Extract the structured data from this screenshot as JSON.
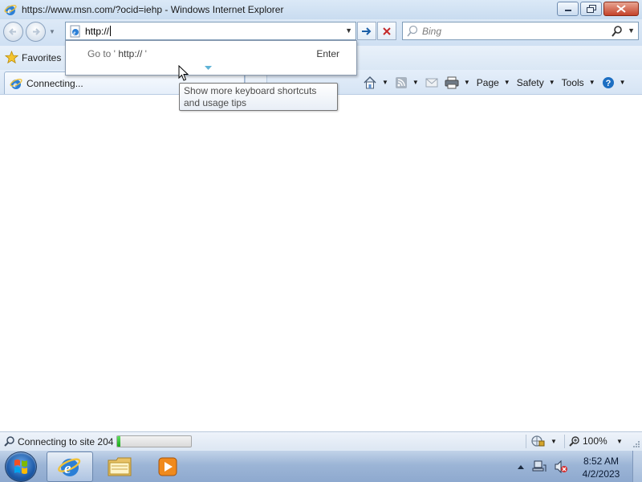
{
  "window": {
    "title": "https://www.msn.com/?ocid=iehp - Windows Internet Explorer",
    "icon": "ie-icon",
    "buttons": [
      "minimize-icon",
      "maximize-icon",
      "close-icon"
    ]
  },
  "navigation": {
    "address_value": "http://",
    "search_placeholder": "Bing"
  },
  "address_dropdown": {
    "goto_prefix": "Go to '",
    "goto_url": " http:// ",
    "goto_suffix": "'",
    "shortcut": "Enter"
  },
  "tooltip": {
    "text": "Show more keyboard shortcuts and usage tips"
  },
  "favorites_bar": {
    "label": "Favorites"
  },
  "tab": {
    "label": "Connecting..."
  },
  "command_bar": {
    "page": "Page",
    "safety": "Safety",
    "tools": "Tools"
  },
  "status_bar": {
    "text": "Connecting to site 204",
    "progress": 0.04,
    "zoom": "100%"
  },
  "taskbar": {
    "apps": [
      "ie-icon",
      "folder-icon",
      "media-player-icon"
    ],
    "active_app": "ie-icon",
    "time": "8:52 AM",
    "date": "4/2/2023"
  },
  "colors": {
    "accent": "#1c6ec2",
    "close_red": "#c4432a",
    "progress_green": "#1aa81a"
  }
}
